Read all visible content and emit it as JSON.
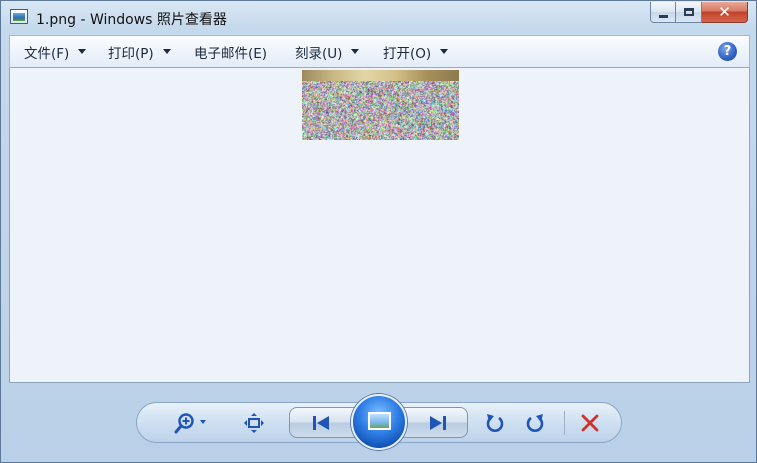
{
  "window": {
    "title": "1.png - Windows 照片查看器"
  },
  "menubar": {
    "items": [
      {
        "label": "文件(F)",
        "has_dropdown": true
      },
      {
        "label": "打印(P)",
        "has_dropdown": true
      },
      {
        "label": "电子邮件(E)",
        "has_dropdown": false
      },
      {
        "label": "刻录(U)",
        "has_dropdown": true
      },
      {
        "label": "打开(O)",
        "has_dropdown": true
      }
    ],
    "help_glyph": "?"
  },
  "controls": {
    "zoom_icon": "zoom-icon",
    "fit_icon": "actual-size-icon",
    "previous_icon": "previous-icon",
    "slideshow_icon": "slideshow-icon",
    "next_icon": "next-icon",
    "rotate_ccw_icon": "rotate-counterclockwise-icon",
    "rotate_cw_icon": "rotate-clockwise-icon",
    "delete_icon": "delete-icon",
    "close_glyph": "✕"
  },
  "colors": {
    "accent": "#2e7ee6",
    "delete": "#d2302c",
    "viewer_bg": "#eef3fa"
  }
}
